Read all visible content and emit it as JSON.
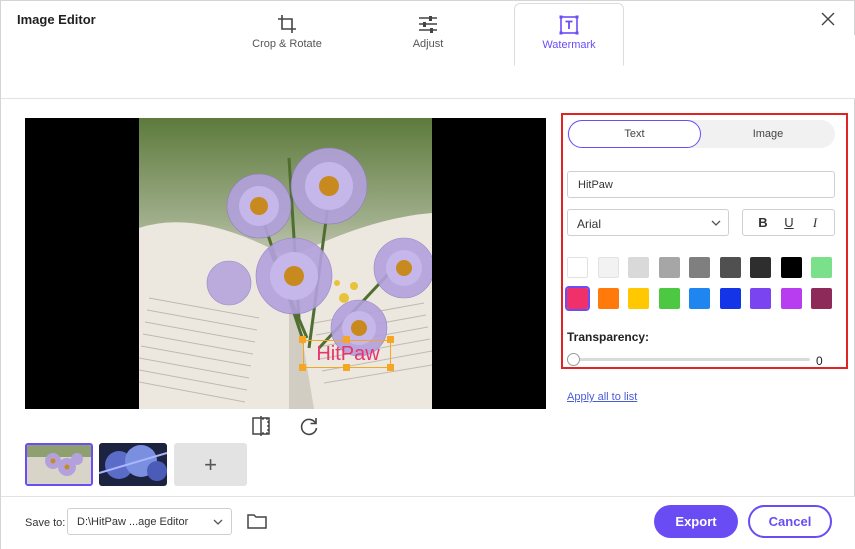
{
  "window": {
    "title": "Image Editor"
  },
  "tabs": [
    {
      "label": "Crop & Rotate",
      "icon": "crop-icon"
    },
    {
      "label": "Adjust",
      "icon": "sliders-icon"
    },
    {
      "label": "Watermark",
      "icon": "watermark-icon",
      "active": true
    }
  ],
  "preview": {
    "watermark_text": "HitPaw"
  },
  "watermark_panel": {
    "mode_tabs": {
      "text": "Text",
      "image": "Image",
      "selected": "Text"
    },
    "text_value": "HitPaw",
    "font": "Arial",
    "style_buttons": {
      "bold": "B",
      "underline": "U",
      "italic": "I"
    },
    "colors_row1": [
      "#ffffff",
      "#f2f2f2",
      "#d9d9d9",
      "#a6a6a6",
      "#7f7f7f",
      "#505050",
      "#2e2e2e",
      "#000000",
      "#7be08a"
    ],
    "colors_row2": [
      "#f0306a",
      "#ff7a0a",
      "#ffc800",
      "#4cc842",
      "#1f86f0",
      "#1434e8",
      "#7a44f0",
      "#b83cf0",
      "#8e2a5a"
    ],
    "selected_color": "#f0306a",
    "transparency_label": "Transparency:",
    "transparency_value": "0",
    "apply_all_label": "Apply all to list"
  },
  "footer": {
    "save_to_label": "Save to:",
    "save_path": "D:\\HitPaw ...age Editor",
    "export_label": "Export",
    "cancel_label": "Cancel"
  },
  "accent_color": "#6a4cf4"
}
